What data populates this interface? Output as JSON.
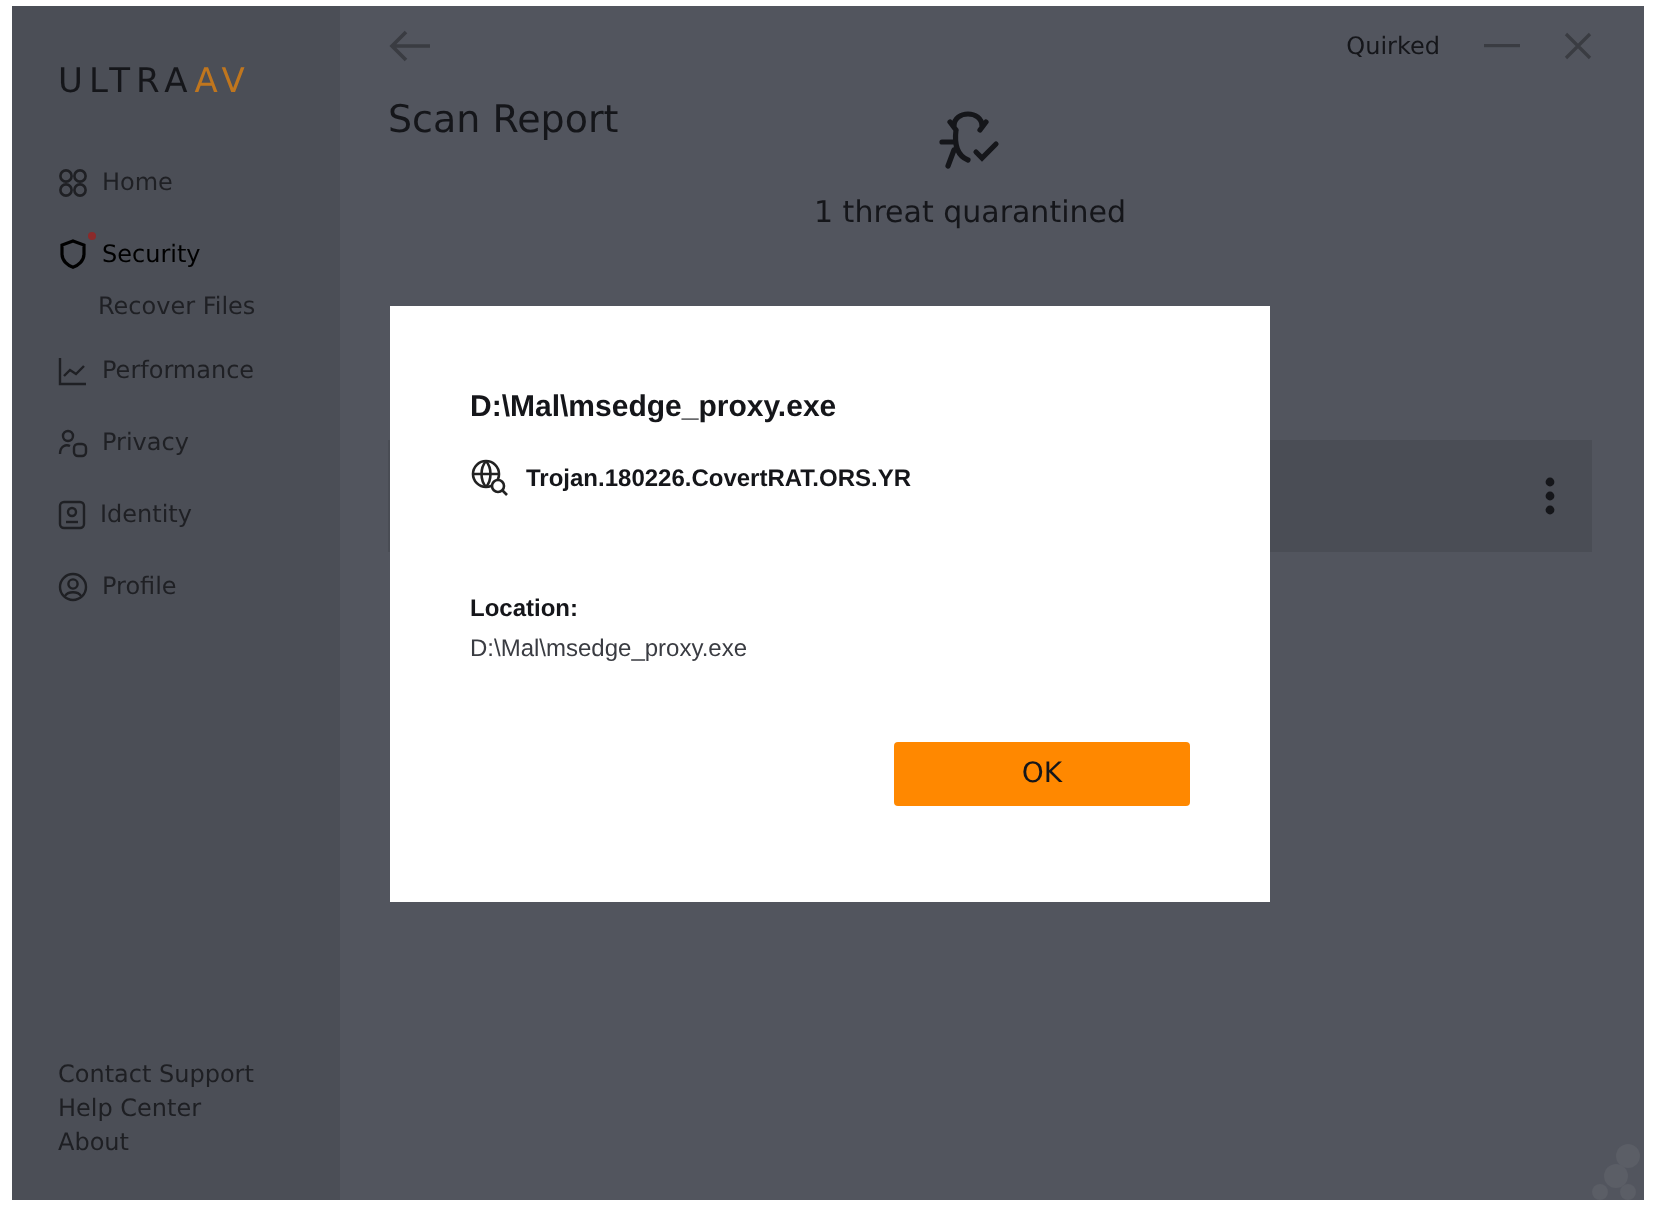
{
  "logo": {
    "part_1": "ULTRA",
    "part_2": "AV"
  },
  "sidebar": {
    "items": [
      {
        "kind": "item",
        "label": "Home",
        "selected": false,
        "alert": false
      },
      {
        "kind": "item",
        "label": "Security",
        "selected": true,
        "alert": true
      },
      {
        "kind": "subitem",
        "label": "Recover Files",
        "selected": false,
        "alert": false
      },
      {
        "kind": "item",
        "label": "Performance",
        "selected": false,
        "alert": false
      },
      {
        "kind": "item",
        "label": "Privacy",
        "selected": false,
        "alert": false
      },
      {
        "kind": "item",
        "label": "Identity",
        "selected": false,
        "alert": false
      },
      {
        "kind": "item",
        "label": "Profile",
        "selected": false,
        "alert": false
      }
    ],
    "footer_links": [
      "Contact Support",
      "Help Center",
      "About"
    ]
  },
  "title_bar": {
    "user": "Quirked"
  },
  "page": {
    "title": "Scan Report",
    "summary": "1 threat quarantined"
  },
  "dialog": {
    "file": "D:\\Mal\\msedge_proxy.exe",
    "threat": "Trojan.180226.CovertRAT.ORS.YR",
    "location_label": "Location:",
    "location": "D:\\Mal\\msedge_proxy.exe",
    "ok": "OK"
  }
}
